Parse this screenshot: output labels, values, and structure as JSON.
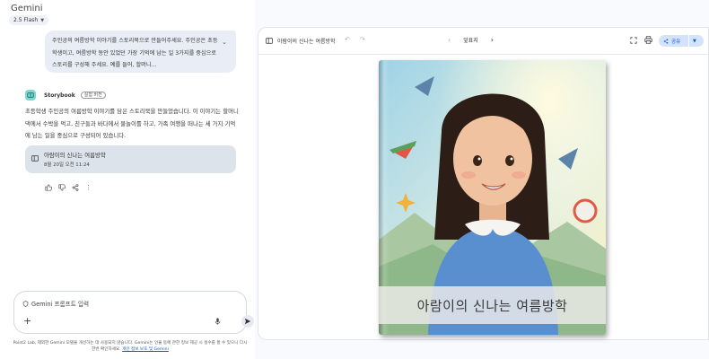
{
  "app": {
    "title": "Gemini",
    "model": "2.5 Flash"
  },
  "chat": {
    "user_prompt": "주인공의 여름방학 이야기를 스토리북으로 만들어주세요. 주인공은 초등학생이고, 여름방학 동안 있었던 가장 기억에 남는 일 3가지를 중심으로 스토리를 구성해 주세요. 예를 들어, 할머니...",
    "assistant_name": "Storybook",
    "assistant_badge": "실험 버전",
    "response": "초등학생 주인공의 여름방학 이야기를 담은 스토리북을 만들었습니다. 이 이야기는 할머니 댁에서 수박을 먹고, 친구들과 바다에서 물놀이를 하고, 가족 여행을 떠나는 세 가지 기억에 남는 일을 중심으로 구성되어 있습니다.",
    "doc_card": {
      "title": "아람이의 신나는 여름방학",
      "date": "8월 20일 오전 11:24"
    }
  },
  "input": {
    "placeholder": "Gemini 프롬프트 입력"
  },
  "disclaimer": {
    "text": "Point2 Lab, 제외한 Gemini 모델을 개선하는 데 사용되지 않습니다. Gemini는 인물 등에 관한 정보 제공 시 실수를 할 수 있으니 다시 한번 확인하세요.",
    "link": "개인 정보 보호 및 Gemini"
  },
  "doc": {
    "title": "아람이의 신나는 여름방학",
    "page_label": "앞표지",
    "share_label": "공유",
    "cover_title": "아람이의 신나는 여름방학"
  },
  "colors": {
    "accent": "#0b57d0",
    "share_bg": "#d3e3fd",
    "bubble_bg": "#e9eef6",
    "card_bg": "#dde3ea",
    "storybook_icon": "#7cd7d0"
  }
}
